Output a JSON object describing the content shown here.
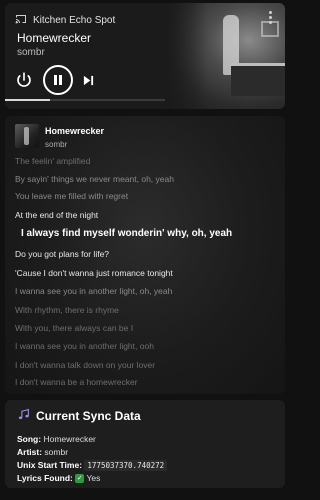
{
  "media": {
    "device": "Kitchen Echo Spot",
    "title": "Homewrecker",
    "artist": "sombr",
    "progress": 0.28,
    "icons": {
      "cast": "cast-icon",
      "menu": "more-vert-icon",
      "power": "power-icon",
      "pause": "pause-icon",
      "next": "skip-next-icon"
    }
  },
  "lyrics": {
    "title": "Homewrecker",
    "artist": "sombr",
    "lines": [
      "The feelin' amplified",
      "By sayin' things we never meant, oh, yeah",
      "You leave me filled with regret",
      "At the end of the night",
      "I always find myself wonderin' why, oh, yeah",
      "Do you got plans for life?",
      "'Cause I don't wanna just romance tonight",
      "I wanna see you in another light, oh, yeah",
      "With rhythm, there is rhyme",
      "With you, there always can be I",
      "I wanna see you in another light, ooh",
      "I don't wanna talk down on your lover",
      "I don't wanna be a homewrecker"
    ],
    "active_index": 4
  },
  "sync": {
    "heading": "Current Sync Data",
    "song_label": "Song:",
    "song_value": "Homewrecker",
    "artist_label": "Artist:",
    "artist_value": "sombr",
    "start_label": "Unix Start Time:",
    "start_value": "1775037370.740272",
    "found_label": "Lyrics Found:",
    "found_value": "Yes",
    "icons": {
      "heading": "music-notes-icon",
      "found": "check-box-icon"
    }
  }
}
